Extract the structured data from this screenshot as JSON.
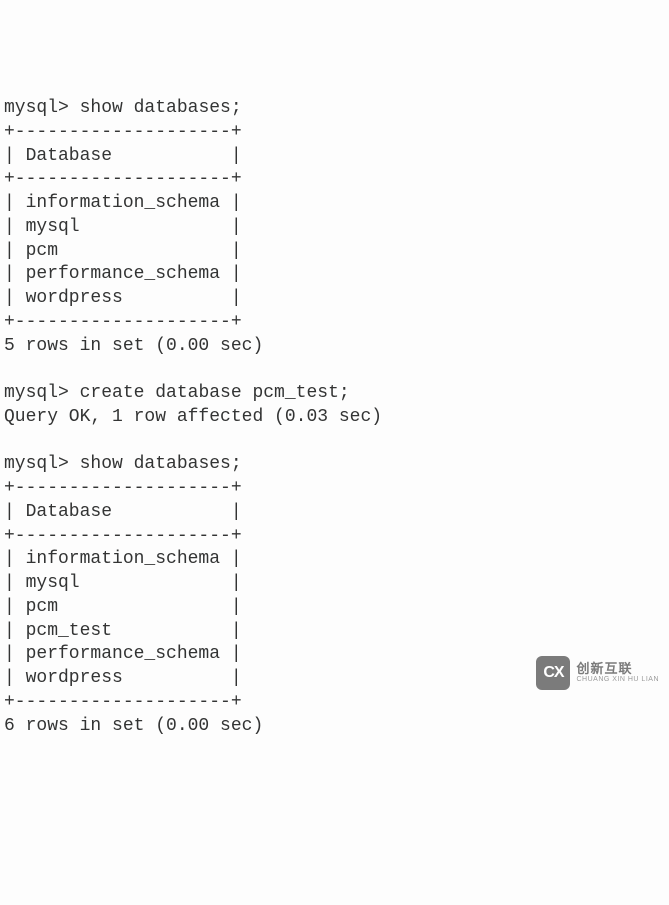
{
  "terminal": {
    "prompt": "mysql>",
    "cmd1": "show databases;",
    "sep": "+--------------------+",
    "header_row": "| Database           |",
    "table1": {
      "rows": [
        "| information_schema |",
        "| mysql              |",
        "| pcm                |",
        "| performance_schema |",
        "| wordpress          |"
      ]
    },
    "result1": "5 rows in set (0.00 sec)",
    "cmd2": "create database pcm_test;",
    "result2": "Query OK, 1 row affected (0.03 sec)",
    "cmd3": "show databases;",
    "table2": {
      "rows": [
        "| information_schema |",
        "| mysql              |",
        "| pcm                |",
        "| pcm_test           |",
        "| performance_schema |",
        "| wordpress          |"
      ]
    },
    "result3": "6 rows in set (0.00 sec)"
  },
  "watermark": {
    "logo_letters": "CX",
    "cn_text": "创新互联",
    "en_text": "CHUANG XIN HU LIAN"
  }
}
